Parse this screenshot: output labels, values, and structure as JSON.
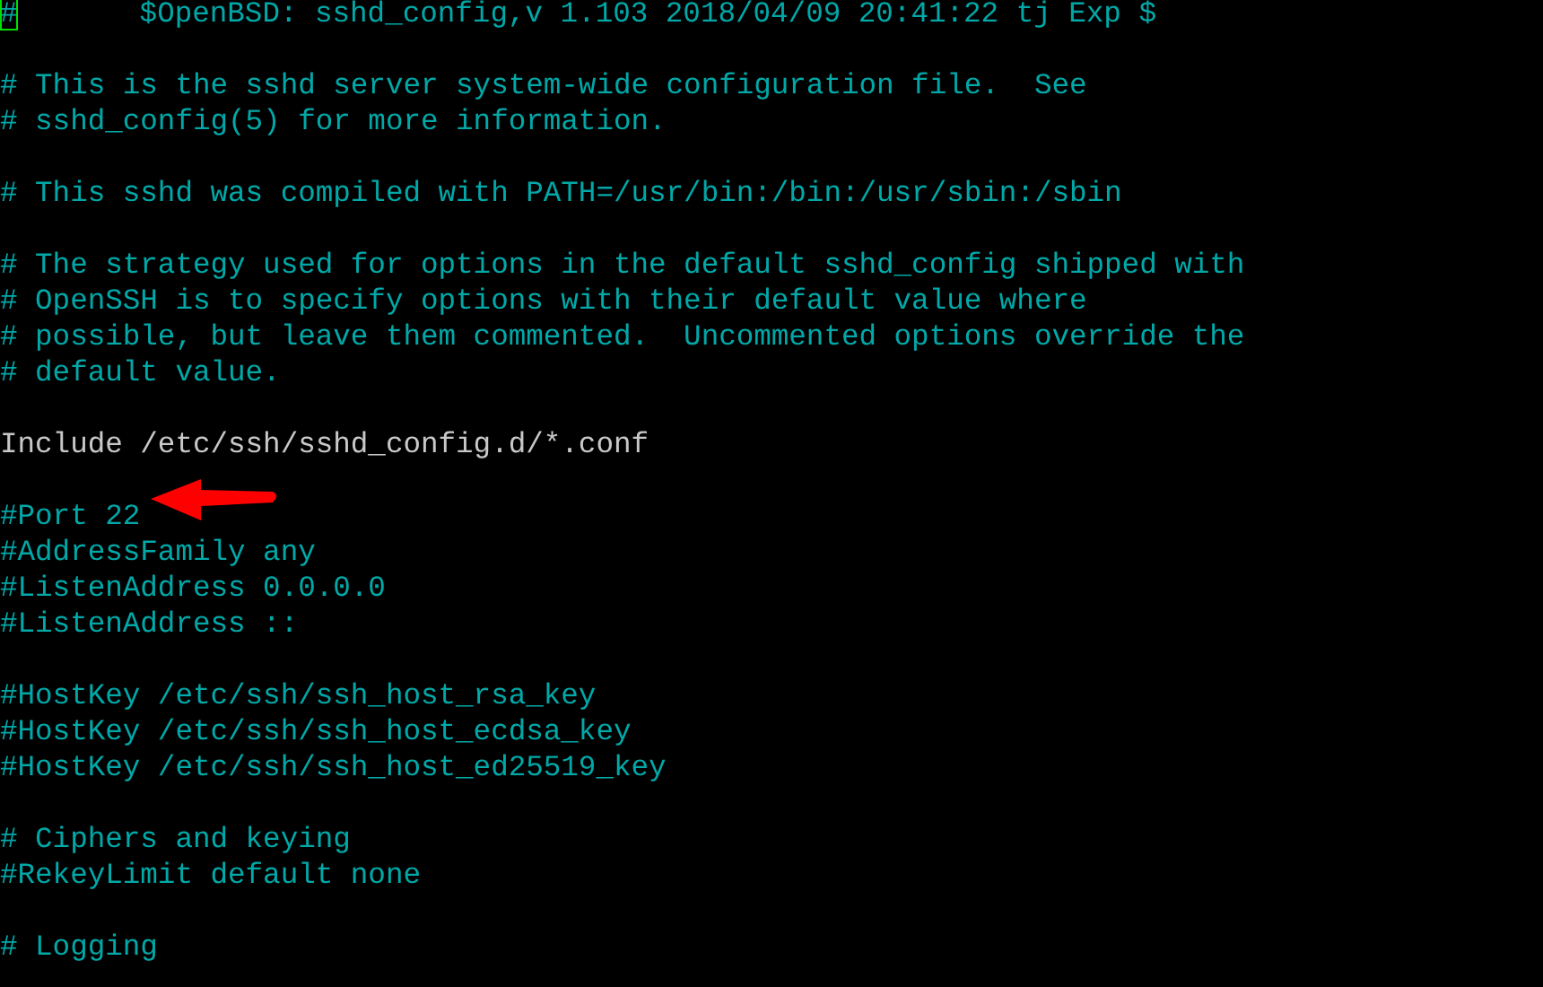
{
  "terminal": {
    "lines": [
      {
        "kind": "comment",
        "cursor": "#",
        "text": "$OpenBSD: sshd_config,v 1.103 2018/04/09 20:41:22 tj Exp $"
      },
      {
        "kind": "blank"
      },
      {
        "kind": "comment",
        "text": "# This is the sshd server system-wide configuration file.  See"
      },
      {
        "kind": "comment",
        "text": "# sshd_config(5) for more information."
      },
      {
        "kind": "blank"
      },
      {
        "kind": "comment",
        "text": "# This sshd was compiled with PATH=/usr/bin:/bin:/usr/sbin:/sbin"
      },
      {
        "kind": "blank"
      },
      {
        "kind": "comment",
        "text": "# The strategy used for options in the default sshd_config shipped with"
      },
      {
        "kind": "comment",
        "text": "# OpenSSH is to specify options with their default value where"
      },
      {
        "kind": "comment",
        "text": "# possible, but leave them commented.  Uncommented options override the"
      },
      {
        "kind": "comment",
        "text": "# default value."
      },
      {
        "kind": "blank"
      },
      {
        "kind": "directive",
        "text": "Include /etc/ssh/sshd_config.d/*.conf"
      },
      {
        "kind": "blank"
      },
      {
        "kind": "comment",
        "text": "#Port 22",
        "annotated": true
      },
      {
        "kind": "comment",
        "text": "#AddressFamily any"
      },
      {
        "kind": "comment",
        "text": "#ListenAddress 0.0.0.0"
      },
      {
        "kind": "comment",
        "text": "#ListenAddress ::"
      },
      {
        "kind": "blank"
      },
      {
        "kind": "comment",
        "text": "#HostKey /etc/ssh/ssh_host_rsa_key"
      },
      {
        "kind": "comment",
        "text": "#HostKey /etc/ssh/ssh_host_ecdsa_key"
      },
      {
        "kind": "comment",
        "text": "#HostKey /etc/ssh/ssh_host_ed25519_key"
      },
      {
        "kind": "blank"
      },
      {
        "kind": "comment",
        "text": "# Ciphers and keying"
      },
      {
        "kind": "comment",
        "text": "#RekeyLimit default none"
      },
      {
        "kind": "blank"
      },
      {
        "kind": "comment",
        "text": "# Logging"
      }
    ]
  }
}
